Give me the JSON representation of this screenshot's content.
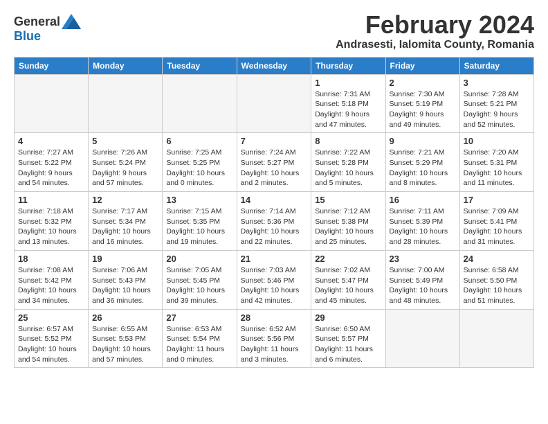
{
  "logo": {
    "general": "General",
    "blue": "Blue"
  },
  "title": {
    "month": "February 2024",
    "location": "Andrasesti, Ialomita County, Romania"
  },
  "weekdays": [
    "Sunday",
    "Monday",
    "Tuesday",
    "Wednesday",
    "Thursday",
    "Friday",
    "Saturday"
  ],
  "weeks": [
    [
      {
        "day": "",
        "info": ""
      },
      {
        "day": "",
        "info": ""
      },
      {
        "day": "",
        "info": ""
      },
      {
        "day": "",
        "info": ""
      },
      {
        "day": "1",
        "info": "Sunrise: 7:31 AM\nSunset: 5:18 PM\nDaylight: 9 hours\nand 47 minutes."
      },
      {
        "day": "2",
        "info": "Sunrise: 7:30 AM\nSunset: 5:19 PM\nDaylight: 9 hours\nand 49 minutes."
      },
      {
        "day": "3",
        "info": "Sunrise: 7:28 AM\nSunset: 5:21 PM\nDaylight: 9 hours\nand 52 minutes."
      }
    ],
    [
      {
        "day": "4",
        "info": "Sunrise: 7:27 AM\nSunset: 5:22 PM\nDaylight: 9 hours\nand 54 minutes."
      },
      {
        "day": "5",
        "info": "Sunrise: 7:26 AM\nSunset: 5:24 PM\nDaylight: 9 hours\nand 57 minutes."
      },
      {
        "day": "6",
        "info": "Sunrise: 7:25 AM\nSunset: 5:25 PM\nDaylight: 10 hours\nand 0 minutes."
      },
      {
        "day": "7",
        "info": "Sunrise: 7:24 AM\nSunset: 5:27 PM\nDaylight: 10 hours\nand 2 minutes."
      },
      {
        "day": "8",
        "info": "Sunrise: 7:22 AM\nSunset: 5:28 PM\nDaylight: 10 hours\nand 5 minutes."
      },
      {
        "day": "9",
        "info": "Sunrise: 7:21 AM\nSunset: 5:29 PM\nDaylight: 10 hours\nand 8 minutes."
      },
      {
        "day": "10",
        "info": "Sunrise: 7:20 AM\nSunset: 5:31 PM\nDaylight: 10 hours\nand 11 minutes."
      }
    ],
    [
      {
        "day": "11",
        "info": "Sunrise: 7:18 AM\nSunset: 5:32 PM\nDaylight: 10 hours\nand 13 minutes."
      },
      {
        "day": "12",
        "info": "Sunrise: 7:17 AM\nSunset: 5:34 PM\nDaylight: 10 hours\nand 16 minutes."
      },
      {
        "day": "13",
        "info": "Sunrise: 7:15 AM\nSunset: 5:35 PM\nDaylight: 10 hours\nand 19 minutes."
      },
      {
        "day": "14",
        "info": "Sunrise: 7:14 AM\nSunset: 5:36 PM\nDaylight: 10 hours\nand 22 minutes."
      },
      {
        "day": "15",
        "info": "Sunrise: 7:12 AM\nSunset: 5:38 PM\nDaylight: 10 hours\nand 25 minutes."
      },
      {
        "day": "16",
        "info": "Sunrise: 7:11 AM\nSunset: 5:39 PM\nDaylight: 10 hours\nand 28 minutes."
      },
      {
        "day": "17",
        "info": "Sunrise: 7:09 AM\nSunset: 5:41 PM\nDaylight: 10 hours\nand 31 minutes."
      }
    ],
    [
      {
        "day": "18",
        "info": "Sunrise: 7:08 AM\nSunset: 5:42 PM\nDaylight: 10 hours\nand 34 minutes."
      },
      {
        "day": "19",
        "info": "Sunrise: 7:06 AM\nSunset: 5:43 PM\nDaylight: 10 hours\nand 36 minutes."
      },
      {
        "day": "20",
        "info": "Sunrise: 7:05 AM\nSunset: 5:45 PM\nDaylight: 10 hours\nand 39 minutes."
      },
      {
        "day": "21",
        "info": "Sunrise: 7:03 AM\nSunset: 5:46 PM\nDaylight: 10 hours\nand 42 minutes."
      },
      {
        "day": "22",
        "info": "Sunrise: 7:02 AM\nSunset: 5:47 PM\nDaylight: 10 hours\nand 45 minutes."
      },
      {
        "day": "23",
        "info": "Sunrise: 7:00 AM\nSunset: 5:49 PM\nDaylight: 10 hours\nand 48 minutes."
      },
      {
        "day": "24",
        "info": "Sunrise: 6:58 AM\nSunset: 5:50 PM\nDaylight: 10 hours\nand 51 minutes."
      }
    ],
    [
      {
        "day": "25",
        "info": "Sunrise: 6:57 AM\nSunset: 5:52 PM\nDaylight: 10 hours\nand 54 minutes."
      },
      {
        "day": "26",
        "info": "Sunrise: 6:55 AM\nSunset: 5:53 PM\nDaylight: 10 hours\nand 57 minutes."
      },
      {
        "day": "27",
        "info": "Sunrise: 6:53 AM\nSunset: 5:54 PM\nDaylight: 11 hours\nand 0 minutes."
      },
      {
        "day": "28",
        "info": "Sunrise: 6:52 AM\nSunset: 5:56 PM\nDaylight: 11 hours\nand 3 minutes."
      },
      {
        "day": "29",
        "info": "Sunrise: 6:50 AM\nSunset: 5:57 PM\nDaylight: 11 hours\nand 6 minutes."
      },
      {
        "day": "",
        "info": ""
      },
      {
        "day": "",
        "info": ""
      }
    ]
  ]
}
